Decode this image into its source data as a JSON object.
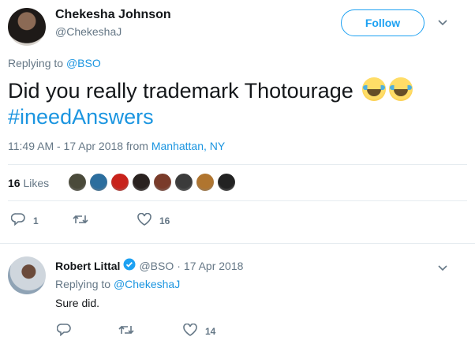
{
  "tweet": {
    "author_name": "Chekesha Johnson",
    "author_handle": "@ChekeshaJ",
    "follow_label": "Follow",
    "replying_prefix": "Replying to",
    "replying_to": "@BSO",
    "text": "Did you really trademark Thotourage",
    "emoji": "😂😂",
    "hashtag": "#ineedAnswers",
    "time_date": "11:49 AM - 17 Apr 2018 from",
    "location": "Manhattan, NY",
    "likes_count": "16",
    "likes_label": "Likes",
    "reply_count": "1",
    "retweet_count": "",
    "like_count": "16"
  },
  "reply": {
    "author_name": "Robert Littal",
    "author_handle": "@BSO",
    "separator": "·",
    "date": "17 Apr 2018",
    "replying_prefix": "Replying to",
    "replying_to": "@ChekeshaJ",
    "text": "Sure did.",
    "like_count": "14"
  },
  "colors": {
    "accent": "#1da1f2",
    "link": "#1b95e0",
    "muted": "#657786",
    "verified": "#1da1f2"
  },
  "liker_colors": [
    "#4a4a3a",
    "#2c6e9e",
    "#c8221b",
    "#2a2220",
    "#7a3b2a",
    "#3b3b3b",
    "#b0752f",
    "#222222"
  ]
}
